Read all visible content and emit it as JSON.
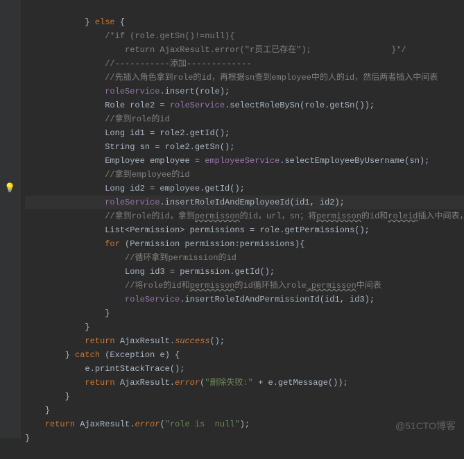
{
  "gutter": {
    "bulb_icon": "💡",
    "bulb_line": 12
  },
  "code": {
    "l1_else": "else",
    "l1_brace": " {",
    "l2": "/*if (role.getSn()!=null){",
    "l3a": "    return AjaxResult.error(\"r员工已存在\");",
    "l3b": "                }*/",
    "l4": "//-----------添加-------------",
    "l5": "//先插入角色拿到role的id，再根据sn查到employee中的人的id，然后两者插入中间表",
    "l6a": "roleService",
    "l6b": ".insert(role);",
    "l7a": "Role role2 = ",
    "l7b": "roleService",
    "l7c": ".selectRoleBySn(role.getSn());",
    "l8": "//拿到role的id",
    "l9": "Long id1 = role2.getId();",
    "l10": "String sn = role2.getSn();",
    "l11a": "Employee employee = ",
    "l11b": "employeeService",
    "l11c": ".selectEmployeeByUsername(sn);",
    "l12": "//拿到employee的id",
    "l13": "Long id2 = employee.getId();",
    "l14a": "roleService",
    "l14b": ".insertRoleIdAndEmployeeId(id1, id2);",
    "l15a": "//拿到role的id，拿到",
    "l15b": "permisson",
    "l15c": "的id，url，sn；将",
    "l15d": "permisson",
    "l15e": "的id和",
    "l15f": "roleid",
    "l15g": "插入中间表，",
    "l16": "List<Permission> permissions = role.getPermissions();",
    "l17a": "for",
    "l17b": " (Permission permission:permissions){",
    "l18": "//循环拿到permission的id",
    "l19": "Long id3 = permission.getId();",
    "l20a": "//将role的id和",
    "l20b": "permisson",
    "l20c": "的id循环插入role",
    "l20d": "_permisson",
    "l20e": "中间表",
    "l21a": "roleService",
    "l21b": ".insertRoleIdAndPermissionId(id1, id3);",
    "l22": "}",
    "l23": "}",
    "l24a": "return",
    "l24b": " AjaxResult.",
    "l24c": "success",
    "l24d": "();",
    "l25a": "} ",
    "l25b": "catch",
    "l25c": " (Exception e) {",
    "l26": "e.printStackTrace();",
    "l27a": "return",
    "l27b": " AjaxResult.",
    "l27c": "error",
    "l27d": "(",
    "l27e": "\"删除失败:\"",
    "l27f": " + e.getMessage());",
    "l28": "}",
    "l29": "}",
    "l30a": "return",
    "l30b": " AjaxResult.",
    "l30c": "error",
    "l30d": "(",
    "l30e": "\"role is  null\"",
    "l30f": ");",
    "l31": "}"
  },
  "watermark": "@51CTO博客"
}
